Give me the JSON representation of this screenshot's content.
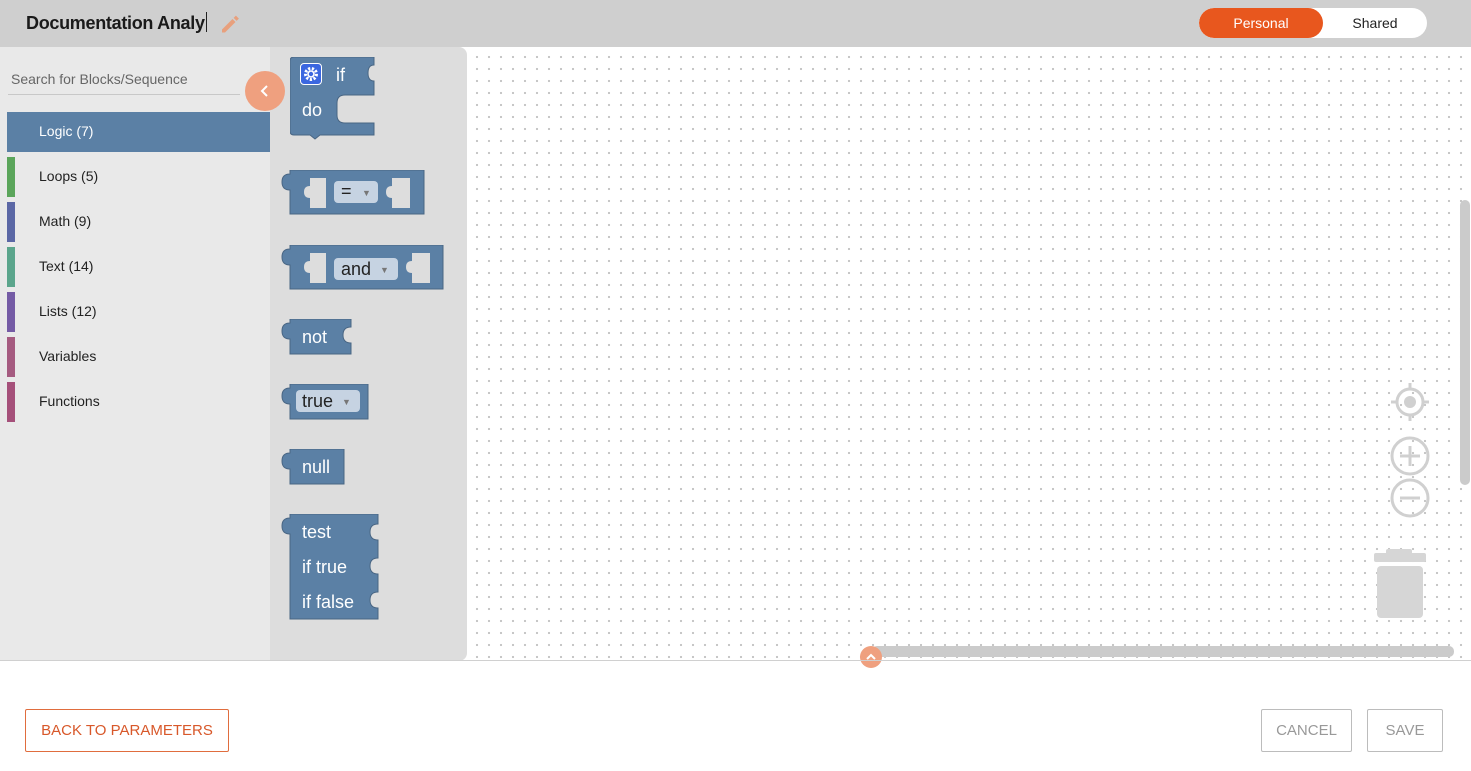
{
  "header": {
    "title": "Documentation Analy",
    "toggle": {
      "personal": "Personal",
      "shared": "Shared",
      "selected": "Personal"
    }
  },
  "sidebar": {
    "search_placeholder": "Search for Blocks/Sequence",
    "categories": [
      {
        "label": "Logic (7)",
        "color": "#5b80a5",
        "selected": true
      },
      {
        "label": "Loops (5)",
        "color": "#5ba55b"
      },
      {
        "label": "Math (9)",
        "color": "#5b67a5"
      },
      {
        "label": "Text (14)",
        "color": "#5ba58c"
      },
      {
        "label": "Lists (12)",
        "color": "#745ba5"
      },
      {
        "label": "Variables",
        "color": "#a55b80"
      },
      {
        "label": "Functions",
        "color": "#a5507a"
      }
    ]
  },
  "flyout": {
    "if_block": {
      "if": "if",
      "do": "do"
    },
    "compare_block": {
      "op": "="
    },
    "logic_op_block": {
      "op": "and"
    },
    "not_block": {
      "label": "not"
    },
    "boolean_block": {
      "value": "true"
    },
    "null_block": {
      "label": "null"
    },
    "ternary_block": {
      "test": "test",
      "if_true": "if true",
      "if_false": "if false"
    },
    "block_color": "#5b80a5"
  },
  "footer": {
    "back": "BACK TO PARAMETERS",
    "cancel": "CANCEL",
    "save": "SAVE"
  },
  "icons": {
    "edit": "pencil-icon",
    "collapse": "chevron-left-icon",
    "center": "target-icon",
    "zoom_in": "zoom-in-icon",
    "zoom_out": "zoom-out-icon",
    "trash": "trash-icon"
  }
}
